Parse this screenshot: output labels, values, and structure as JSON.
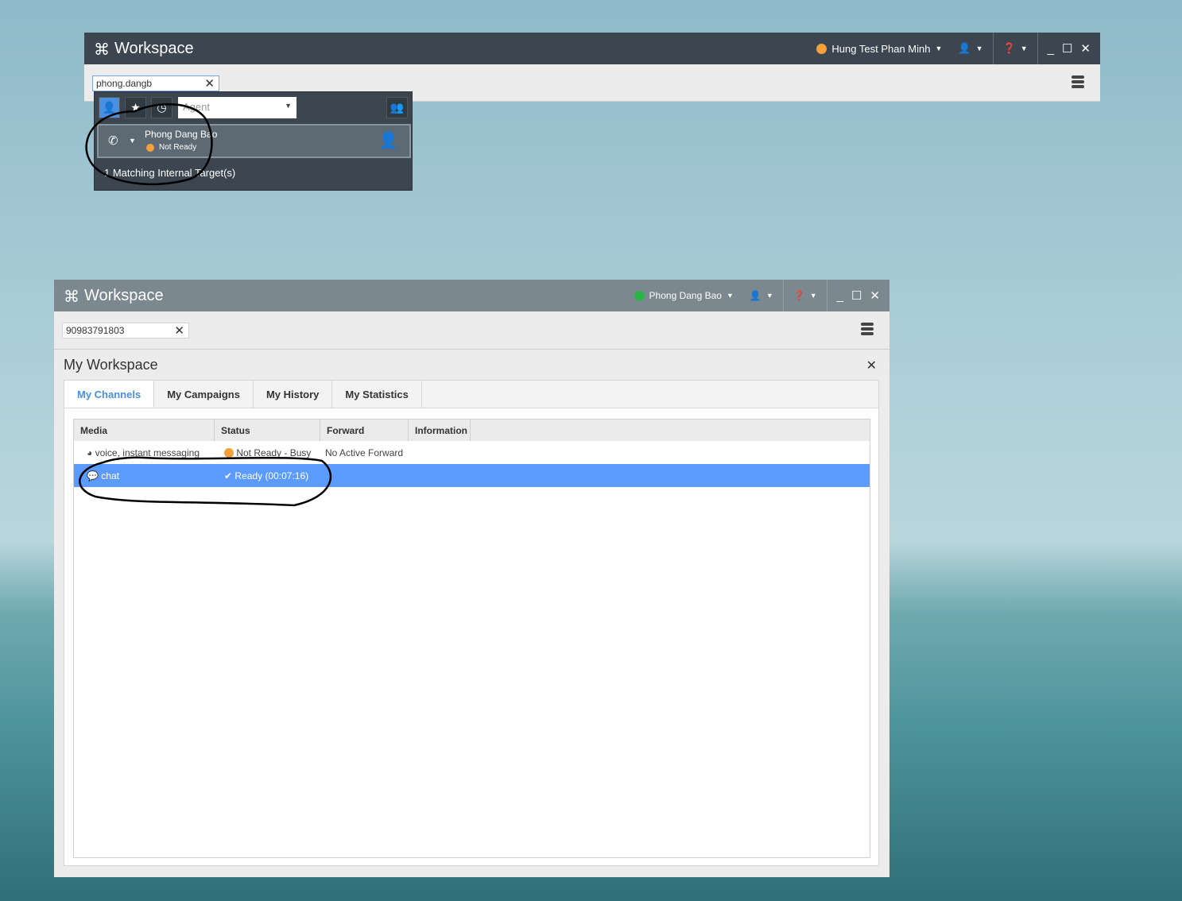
{
  "window1": {
    "title": "Workspace",
    "user": "Hung Test Phan Minh",
    "status_color": "#f5a13a",
    "search_value": "phong.dangb",
    "filter_select": "Agent",
    "result": {
      "name": "Phong Dang Bao",
      "status": "Not Ready"
    },
    "match_text": "1 Matching Internal Target(s)"
  },
  "window2": {
    "title": "Workspace",
    "user": "Phong Dang Bao",
    "status_color": "#2db34a",
    "search_value": "90983791803",
    "panel_title": "My Workspace",
    "tabs": [
      "My Channels",
      "My Campaigns",
      "My History",
      "My Statistics"
    ],
    "columns": [
      "Media",
      "Status",
      "Forward",
      "Information"
    ],
    "rows": [
      {
        "media": "voice, instant messaging",
        "status": "Not Ready - Busy",
        "forward": "No Active Forward",
        "information": ""
      },
      {
        "media": "chat",
        "status": "Ready",
        "timer": "(00:07:16)",
        "forward": "",
        "information": ""
      }
    ]
  },
  "colors": {
    "accent": "#4a90e2",
    "selected": "#5b9bff"
  }
}
